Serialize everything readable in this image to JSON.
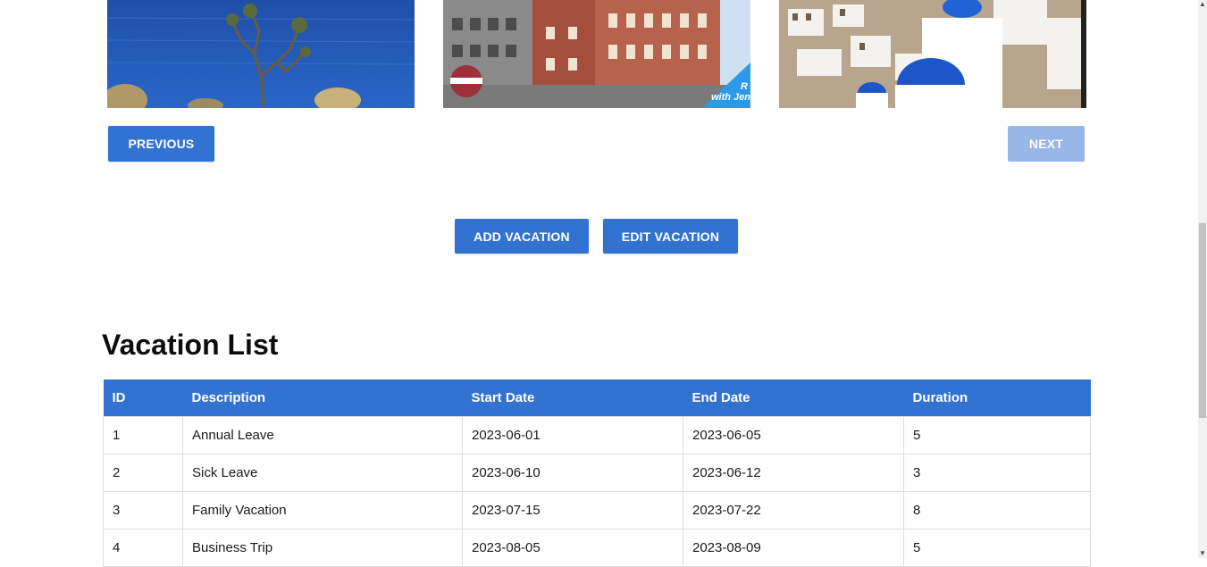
{
  "carousel": {
    "images": [
      {
        "alt": "Coastal view"
      },
      {
        "alt": "Riga old town"
      },
      {
        "alt": "Santorini"
      }
    ],
    "image2_caption_line1": "R",
    "image2_caption_line2": "with Jen"
  },
  "nav": {
    "previous_label": "PREVIOUS",
    "next_label": "NEXT"
  },
  "actions": {
    "add_label": "ADD VACATION",
    "edit_label": "EDIT VACATION"
  },
  "list": {
    "title": "Vacation List",
    "headers": [
      "ID",
      "Description",
      "Start Date",
      "End Date",
      "Duration"
    ],
    "rows": [
      [
        "1",
        "Annual Leave",
        "2023-06-01",
        "2023-06-05",
        "5"
      ],
      [
        "2",
        "Sick Leave",
        "2023-06-10",
        "2023-06-12",
        "3"
      ],
      [
        "3",
        "Family Vacation",
        "2023-07-15",
        "2023-07-22",
        "8"
      ],
      [
        "4",
        "Business Trip",
        "2023-08-05",
        "2023-08-09",
        "5"
      ]
    ]
  },
  "colors": {
    "primary": "#3273d1",
    "disabled": "#98b7e8"
  }
}
